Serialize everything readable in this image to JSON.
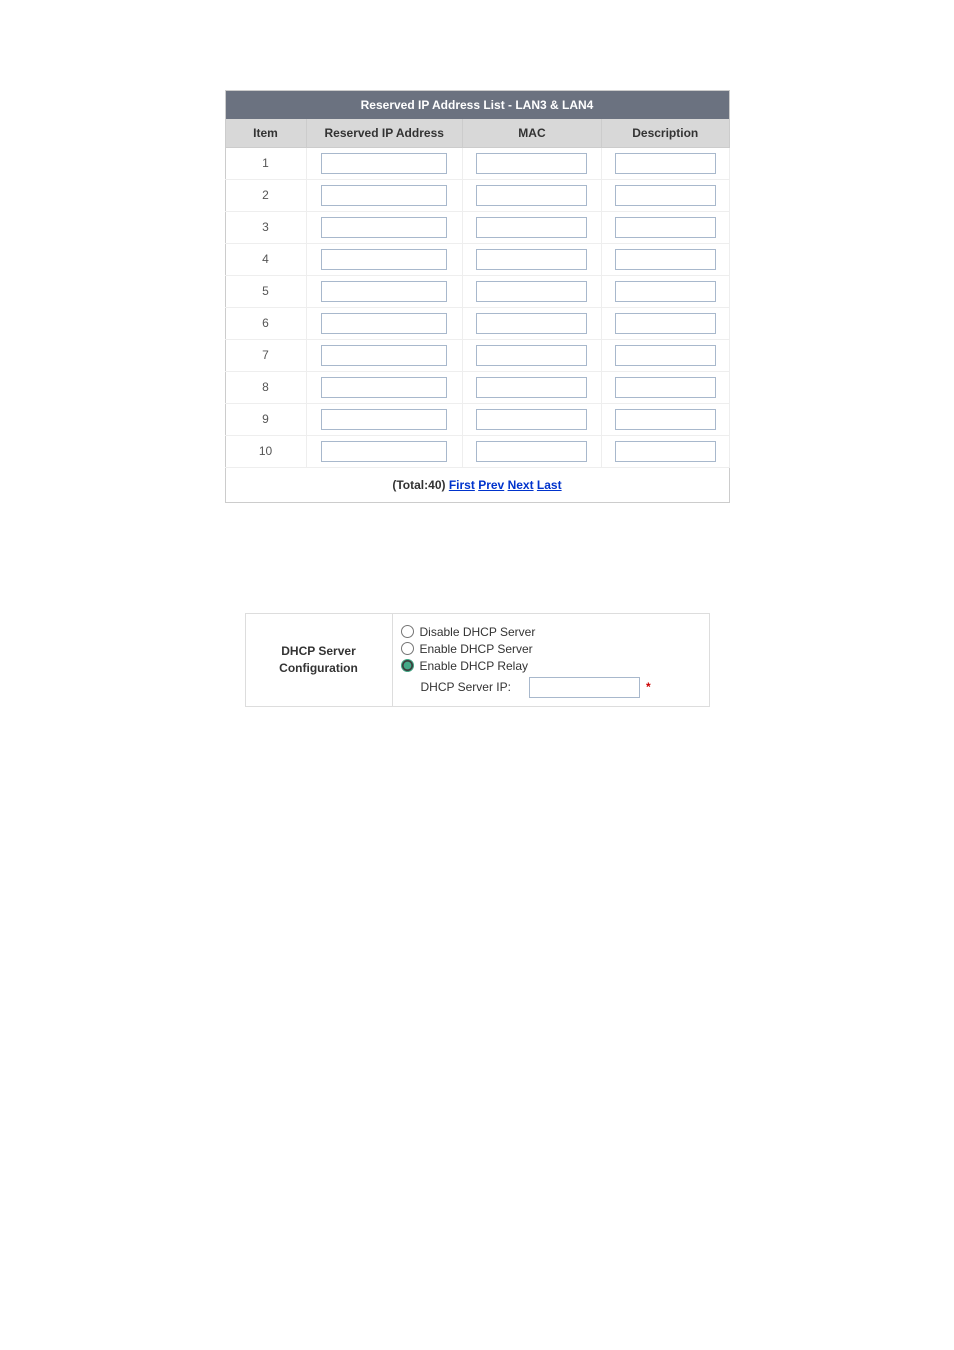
{
  "table": {
    "title": "Reserved IP Address List - LAN3 & LAN4",
    "headers": {
      "item": "Item",
      "ip": "Reserved IP Address",
      "mac": "MAC",
      "desc": "Description"
    },
    "rows": [
      {
        "item": "1",
        "ip": "",
        "mac": "",
        "desc": ""
      },
      {
        "item": "2",
        "ip": "",
        "mac": "",
        "desc": ""
      },
      {
        "item": "3",
        "ip": "",
        "mac": "",
        "desc": ""
      },
      {
        "item": "4",
        "ip": "",
        "mac": "",
        "desc": ""
      },
      {
        "item": "5",
        "ip": "",
        "mac": "",
        "desc": ""
      },
      {
        "item": "6",
        "ip": "",
        "mac": "",
        "desc": ""
      },
      {
        "item": "7",
        "ip": "",
        "mac": "",
        "desc": ""
      },
      {
        "item": "8",
        "ip": "",
        "mac": "",
        "desc": ""
      },
      {
        "item": "9",
        "ip": "",
        "mac": "",
        "desc": ""
      },
      {
        "item": "10",
        "ip": "",
        "mac": "",
        "desc": ""
      }
    ],
    "pager": {
      "total_label": "(Total:40)",
      "first": "First",
      "prev": "Prev",
      "next": "Next",
      "last": "Last"
    }
  },
  "dhcp": {
    "label_line1": "DHCP Server",
    "label_line2": "Configuration",
    "options": {
      "disable": "Disable DHCP Server",
      "enable": "Enable DHCP Server",
      "relay": "Enable DHCP Relay"
    },
    "selected": "relay",
    "server_ip_label": "DHCP Server IP:",
    "server_ip_value": "",
    "required_mark": "*"
  }
}
